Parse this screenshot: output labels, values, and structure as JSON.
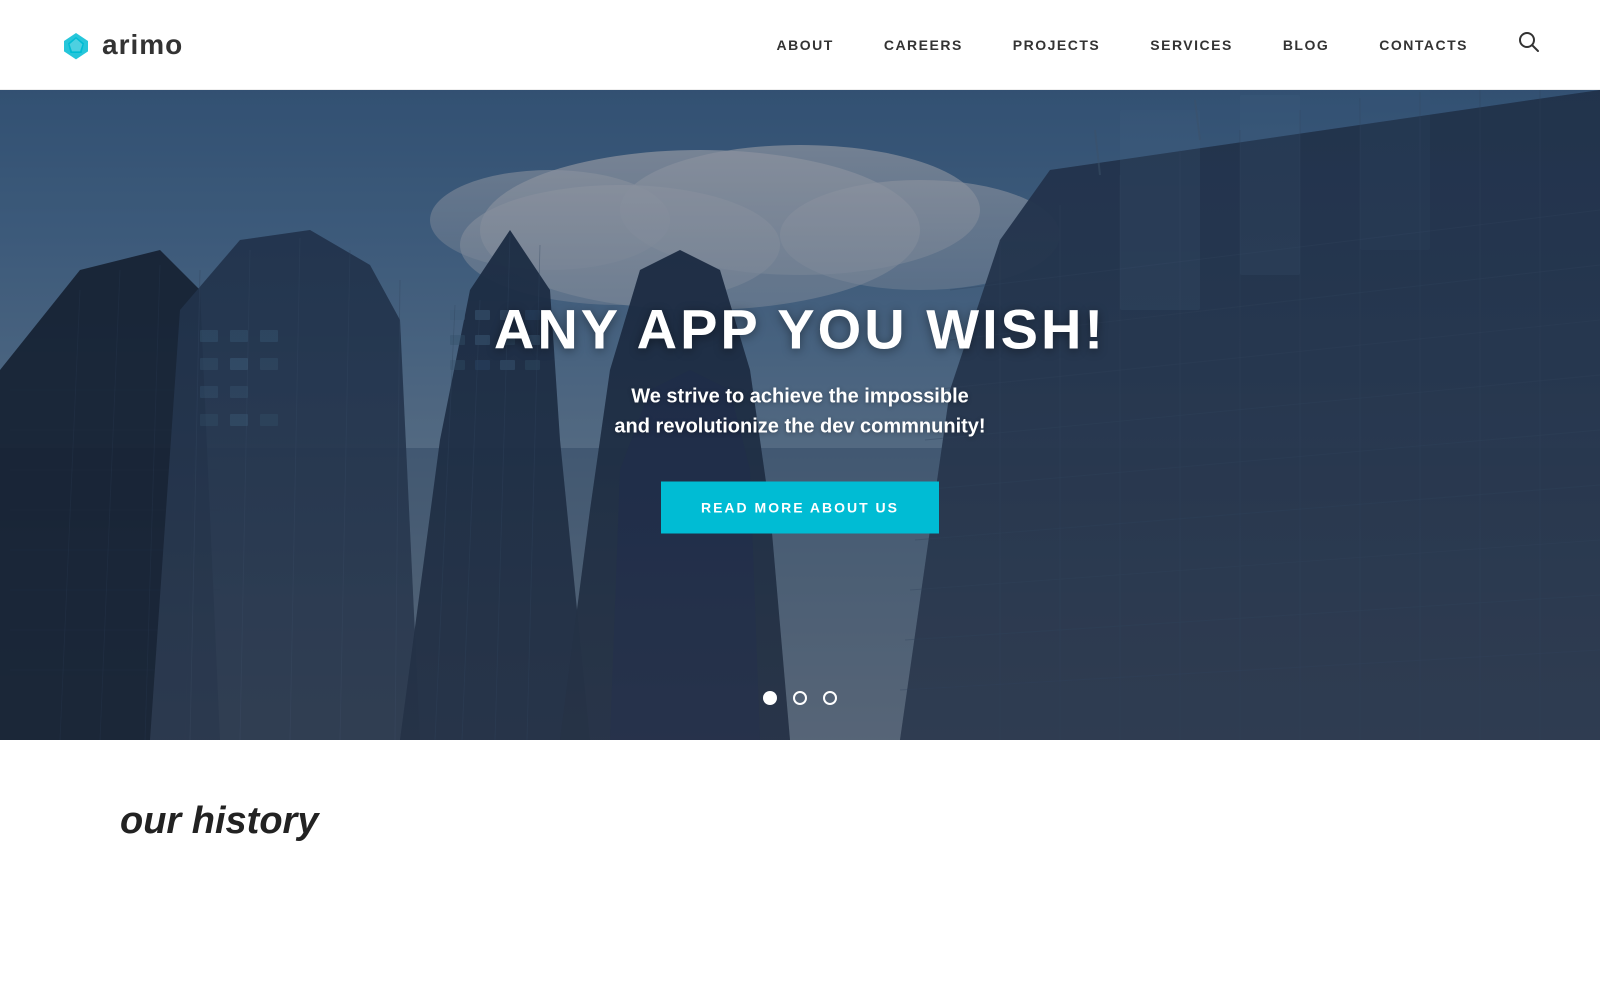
{
  "header": {
    "logo_text": "arimo",
    "nav": {
      "items": [
        {
          "label": "ABOUT",
          "id": "about"
        },
        {
          "label": "CAREERS",
          "id": "careers"
        },
        {
          "label": "PROJECTS",
          "id": "projects"
        },
        {
          "label": "SERVICES",
          "id": "services"
        },
        {
          "label": "BLOG",
          "id": "blog"
        },
        {
          "label": "CONTACTS",
          "id": "contacts"
        }
      ]
    }
  },
  "hero": {
    "title": "ANY APP YOU WISH!",
    "subtitle_line1": "We strive to achieve the impossible",
    "subtitle_line2": "and revolutionize the dev commnunity!",
    "cta_button": "READ MORE ABOUT US",
    "dots": [
      {
        "active": true
      },
      {
        "active": false
      },
      {
        "active": false
      }
    ]
  },
  "below": {
    "section_title": "our history"
  },
  "colors": {
    "accent": "#00bcd4",
    "logo_diamond": "#00bcd4",
    "nav_text": "#333333",
    "hero_title": "#ffffff",
    "hero_subtitle": "#ffffff"
  }
}
